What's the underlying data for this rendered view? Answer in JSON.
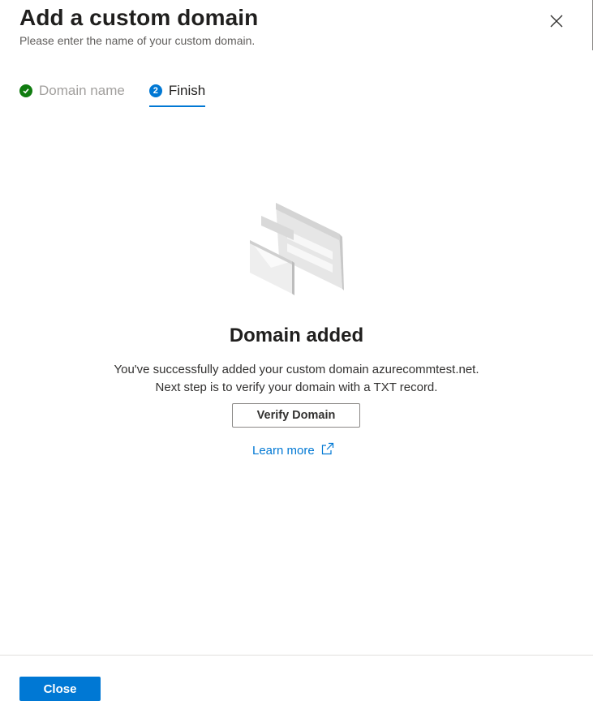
{
  "panel": {
    "title": "Add a custom domain",
    "subtitle": "Please enter the name of your custom domain."
  },
  "steps": [
    {
      "number": "1",
      "label": "Domain name",
      "state": "completed"
    },
    {
      "number": "2",
      "label": "Finish",
      "state": "active"
    }
  ],
  "result": {
    "title": "Domain added",
    "line1": "You've successfully added your custom domain azurecommtest.net.",
    "line2": "Next step is to verify your domain with a TXT record.",
    "verify_label": "Verify Domain",
    "learn_more_label": "Learn more"
  },
  "footer": {
    "close_label": "Close"
  },
  "icons": {
    "close": "close-icon",
    "step_done": "checkmark-circle-icon",
    "external": "external-link-icon",
    "illustration": "email-envelope-illustration"
  },
  "colors": {
    "accent": "#0078d4",
    "success": "#107c10",
    "text": "#323130",
    "muted": "#a19f9d"
  }
}
